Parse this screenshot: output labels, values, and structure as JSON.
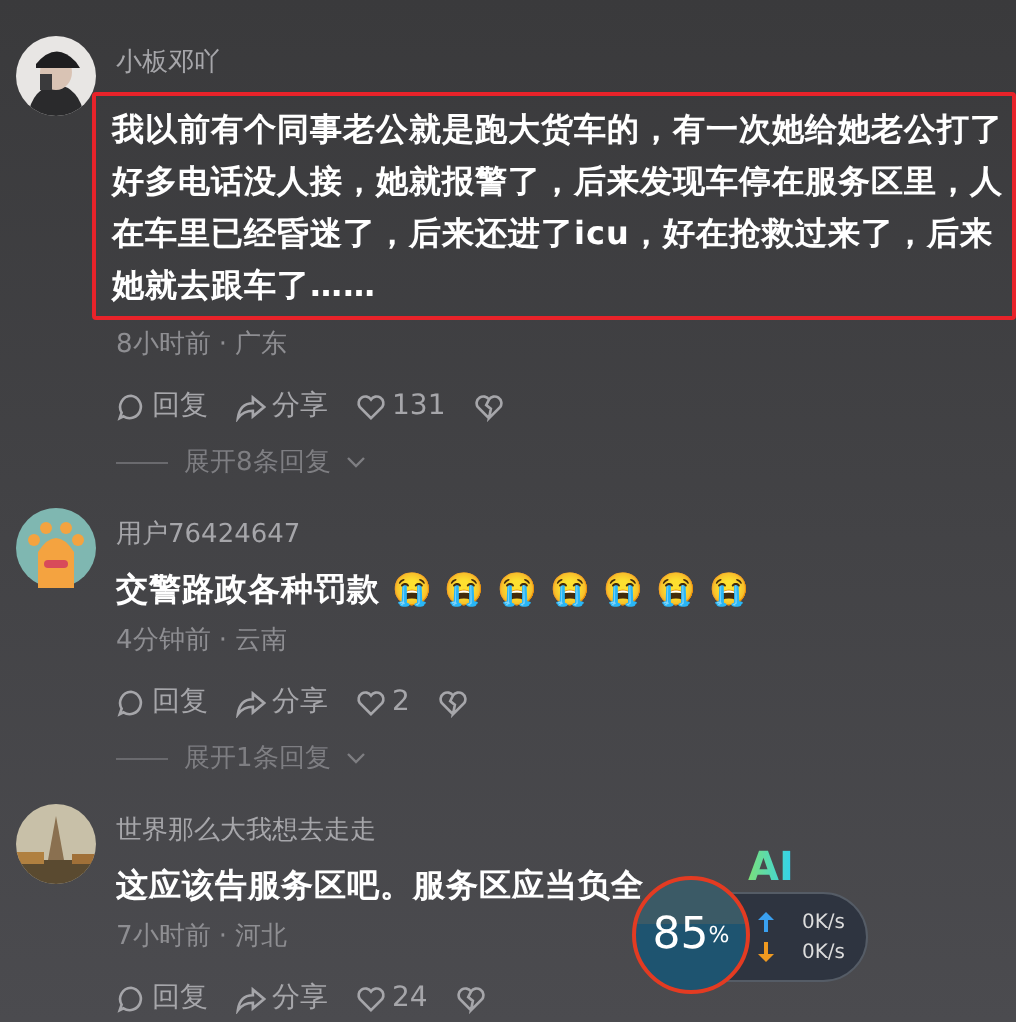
{
  "comments": [
    {
      "user": "小板邓吖",
      "text": "我以前有个同事老公就是跑大货车的，有一次她给她老公打了好多电话没人接，她就报警了，后来发现车停在服务区里，人在车里已经昏迷了，后来还进了icu，好在抢救过来了，后来她就去跟车了……",
      "highlighted": true,
      "meta": "8小时前 · 广东",
      "reply": "回复",
      "share": "分享",
      "likes": "131",
      "expand": "展开8条回复"
    },
    {
      "user": "用户76424647",
      "text": "交警路政各种罚款",
      "emojis": [
        "😭",
        "😭",
        "😭",
        "😭",
        "😭",
        "😭",
        "😭"
      ],
      "highlighted": false,
      "meta": "4分钟前 · 云南",
      "reply": "回复",
      "share": "分享",
      "likes": "2",
      "expand": "展开1条回复"
    },
    {
      "user": "世界那么大我想去走走",
      "text": "这应该告服务区吧。服务区应当负全",
      "highlighted": false,
      "meta": "7小时前 · 河北",
      "reply": "回复",
      "share": "分享",
      "likes": "24"
    }
  ],
  "speed_widget": {
    "badge": "AI",
    "percent": "85",
    "unit": "%",
    "upload": "0K/s",
    "download": "0K/s"
  }
}
